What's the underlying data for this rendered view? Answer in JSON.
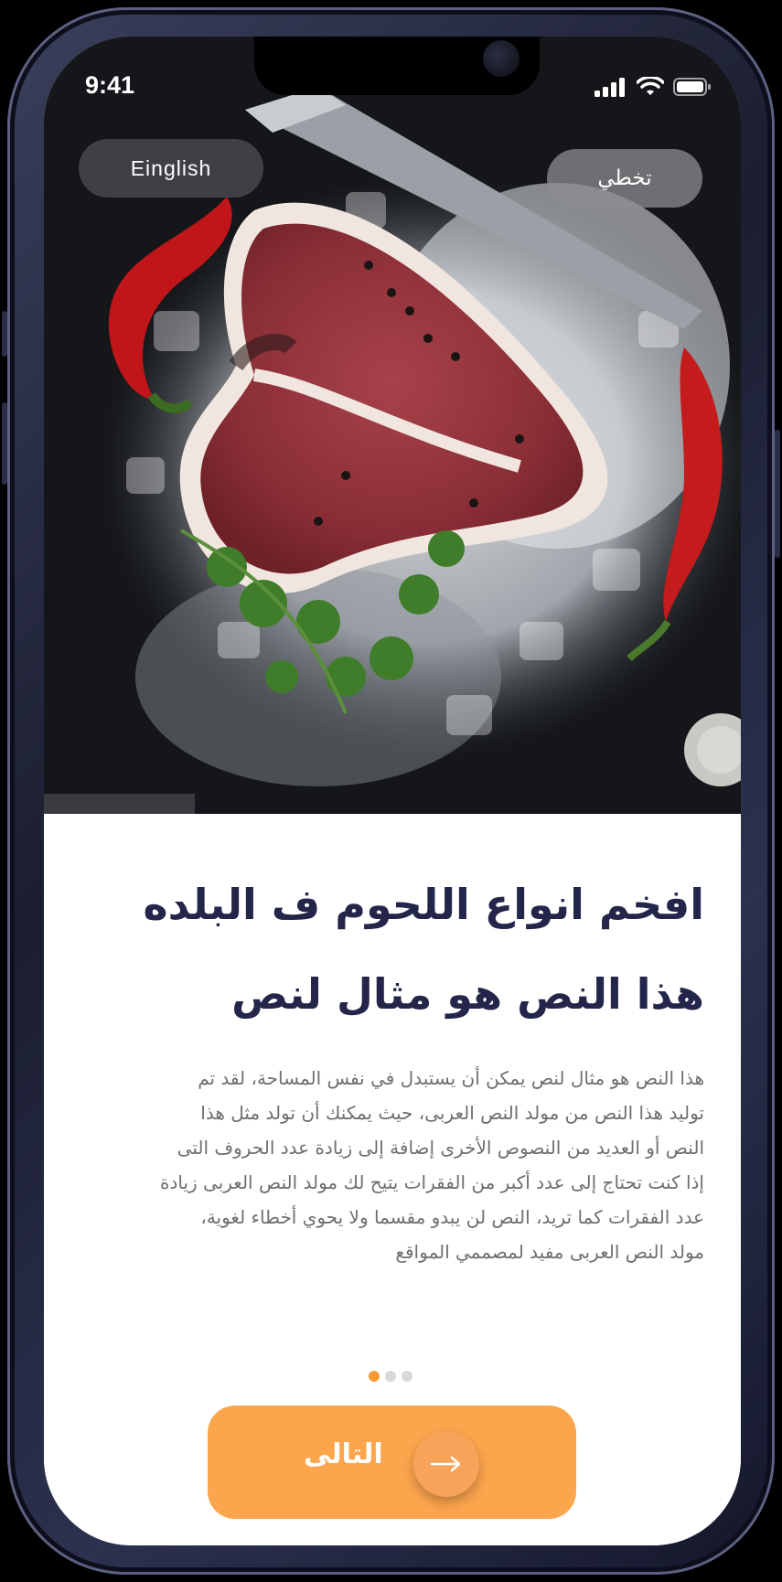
{
  "status_bar": {
    "time": "9:41",
    "icons": [
      "signal-icon",
      "wifi-icon",
      "battery-icon"
    ]
  },
  "header": {
    "language_label": "Einglish",
    "skip_label": "تخطي"
  },
  "hero_image": {
    "subject": "steak-on-ice-icon"
  },
  "onboarding": {
    "title_line1": "افخم انواع اللحوم ف البلده",
    "title_line2": "هذا النص هو مثال لنص",
    "description": [
      "هذا النص هو مثال لنص يمكن أن يستبدل في نفس المساحة، لقد تم",
      "توليد هذا النص من مولد النص العربى، حيث يمكنك أن تولد مثل هذا",
      "النص أو العديد من النصوص الأخرى إضافة إلى زيادة عدد الحروف التى",
      "إذا كنت تحتاج إلى عدد أكبر من الفقرات يتيح لك مولد النص العربى زيادة",
      "عدد الفقرات كما تريد، النص لن يبدو مقسما ولا يحوي أخطاء لغوية،",
      "مولد النص العربى مفيد لمصممي المواقع"
    ],
    "page_indicator": {
      "total": 3,
      "active": 1
    },
    "next_label": "التالى"
  },
  "colors": {
    "accent": "#fca54d",
    "accent_dot": "#f99a34",
    "title": "#23264a",
    "body_text": "#6e6e6e"
  }
}
